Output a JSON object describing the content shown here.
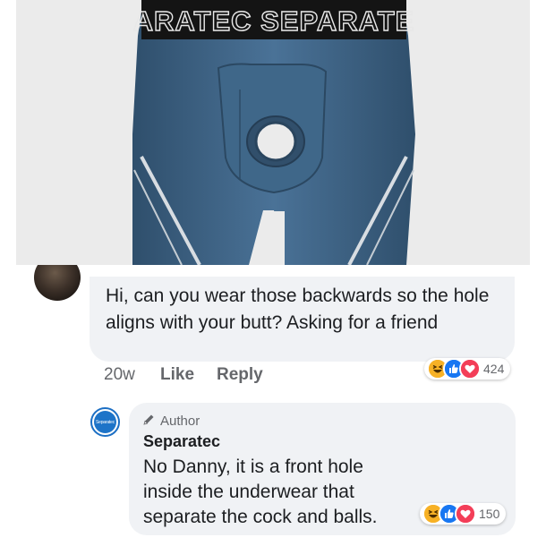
{
  "post_image": {
    "waistband_text": "ARATEC SEPARATE",
    "colors": {
      "fabric": "#3d6283",
      "background": "#ebebeb",
      "waistband": "#111111"
    }
  },
  "comment": {
    "text": "Hi, can you wear those backwards so the hole aligns with your butt? Asking for a friend",
    "time": "20w",
    "like_label": "Like",
    "reply_label": "Reply",
    "reaction_count": "424",
    "reactions": [
      "haha-icon",
      "like-icon",
      "love-icon"
    ]
  },
  "reply": {
    "avatar_text": "Separatec",
    "badge_label": "Author",
    "author_name": "Separatec",
    "text": "No Danny, it is a front hole inside the underwear that separate the cock and balls.",
    "reaction_count": "150",
    "reactions": [
      "haha-icon",
      "like-icon",
      "love-icon"
    ]
  },
  "colors": {
    "bubble": "#f0f2f5",
    "meta_text": "#65676b",
    "like_blue": "#1877f2",
    "love_red": "#f33e58",
    "haha_yellow": "#f7b125"
  }
}
